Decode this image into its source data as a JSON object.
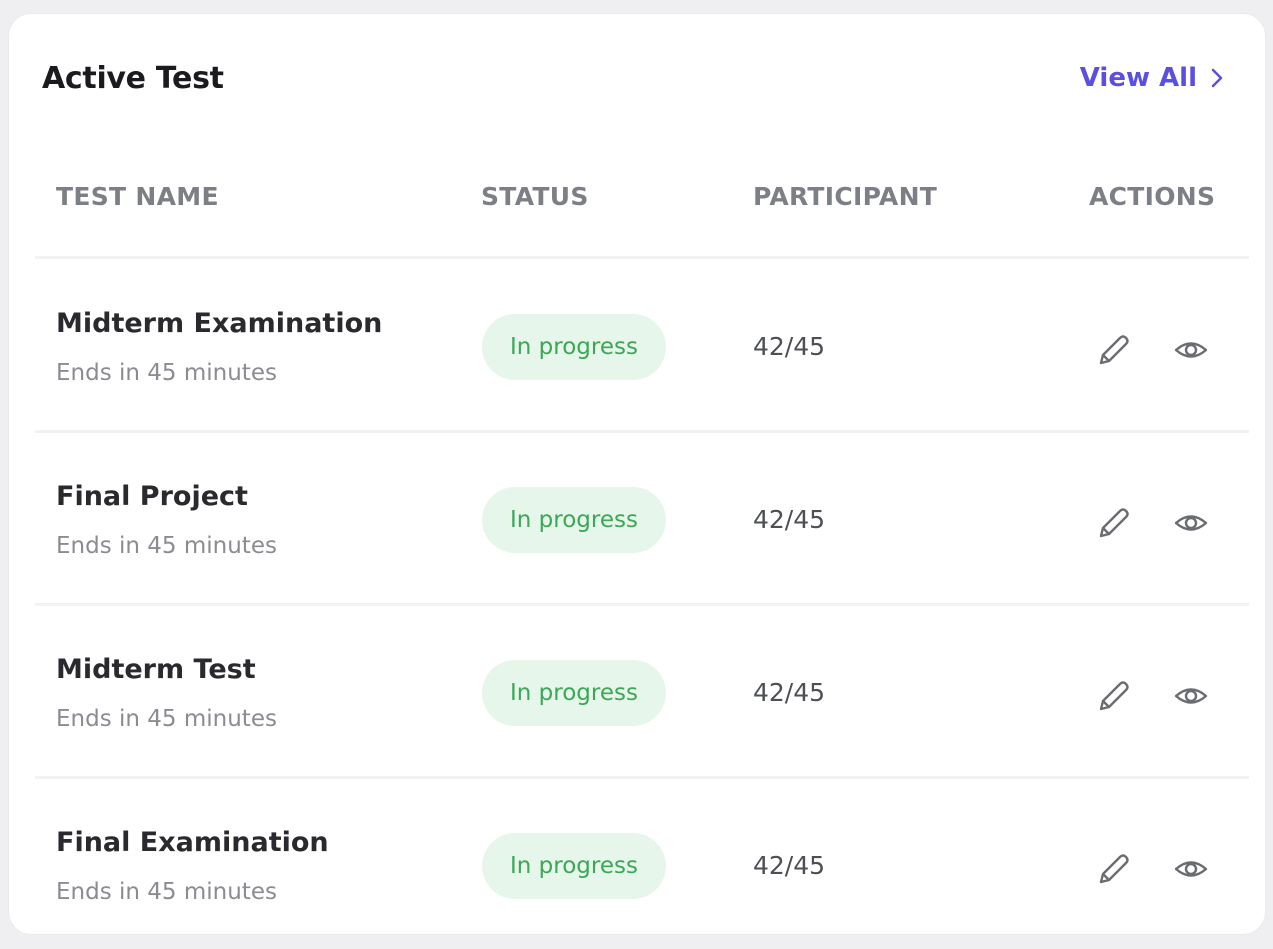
{
  "card": {
    "title": "Active Test",
    "view_all_label": "View All"
  },
  "columns": {
    "name": "TEST NAME",
    "status": "STATUS",
    "participant": "PARTICIPANT",
    "actions": "ACTIONS"
  },
  "rows": [
    {
      "name": "Midterm Examination",
      "subtitle": "Ends in 45 minutes",
      "status": "In progress",
      "participants": "42/45"
    },
    {
      "name": "Final Project",
      "subtitle": "Ends in 45 minutes",
      "status": "In progress",
      "participants": "42/45"
    },
    {
      "name": "Midterm Test",
      "subtitle": "Ends in 45 minutes",
      "status": "In progress",
      "participants": "42/45"
    },
    {
      "name": "Final Examination",
      "subtitle": "Ends in 45 minutes",
      "status": "In progress",
      "participants": "42/45"
    }
  ],
  "icons": {
    "view_all": "chevron-right-icon",
    "edit": "pencil-icon",
    "view": "eye-icon"
  },
  "colors": {
    "accent": "#5b4fe0",
    "status_text": "#3aa857",
    "status_bg": "#e7f6ea"
  }
}
